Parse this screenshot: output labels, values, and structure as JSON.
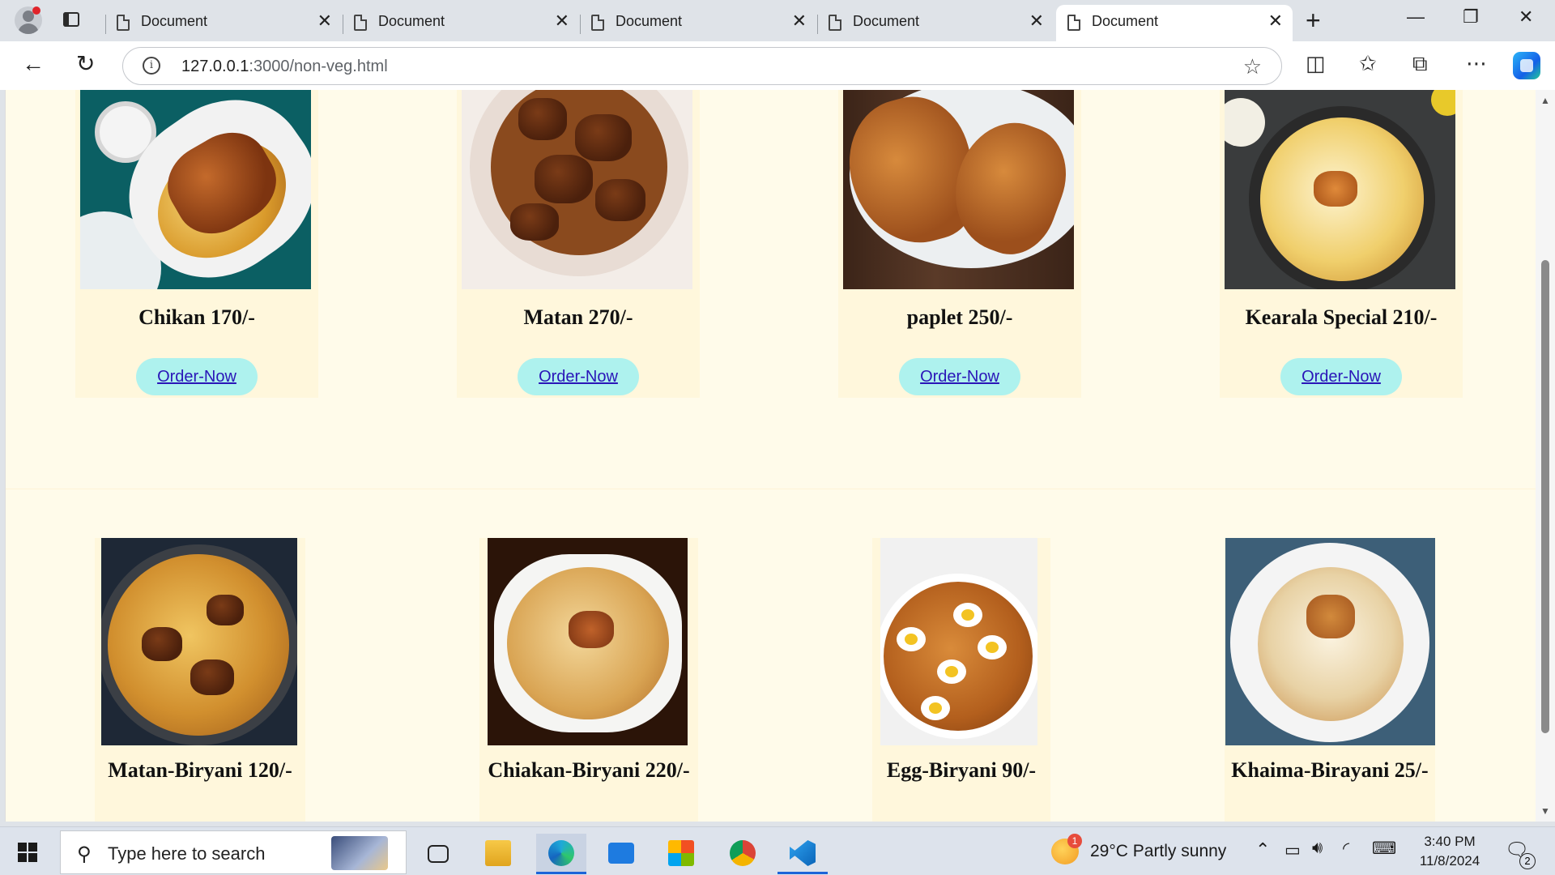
{
  "browser": {
    "tabs": [
      {
        "title": "Document",
        "close": "✕"
      },
      {
        "title": "Document",
        "close": "✕"
      },
      {
        "title": "Document",
        "close": "✕"
      },
      {
        "title": "Document",
        "close": "✕"
      },
      {
        "title": "Document",
        "close": "✕"
      }
    ],
    "active_tab_index": 4,
    "new_tab": "+",
    "window_controls": {
      "minimize": "—",
      "restore": "❐",
      "close": "✕"
    },
    "address": {
      "host": "127.0.0.1",
      "path": ":3000/non-veg.html"
    },
    "icons": [
      "back-icon",
      "refresh-icon",
      "info-icon",
      "favorite-star-icon",
      "split-screen-icon",
      "favorites-icon",
      "collections-icon",
      "more-icon",
      "copilot-icon"
    ]
  },
  "menu": {
    "row1": [
      {
        "label": "Chikan 170/-",
        "button": "Order-Now"
      },
      {
        "label": "Matan 270/-",
        "button": "Order-Now"
      },
      {
        "label": "paplet 250/-",
        "button": "Order-Now"
      },
      {
        "label": "Kearala Special 210/-",
        "button": "Order-Now"
      }
    ],
    "row2": [
      {
        "label": "Matan-Biryani 120/-"
      },
      {
        "label": "Chiakan-Biryani 220/-"
      },
      {
        "label": "Egg-Biryani 90/-"
      },
      {
        "label": "Khaima-Birayani 25/-"
      }
    ]
  },
  "taskbar": {
    "search_placeholder": "Type here to search",
    "weather": "29°C  Partly sunny",
    "weather_badge": "1",
    "time": "3:40 PM",
    "date": "11/8/2024",
    "notification_count": "2"
  }
}
